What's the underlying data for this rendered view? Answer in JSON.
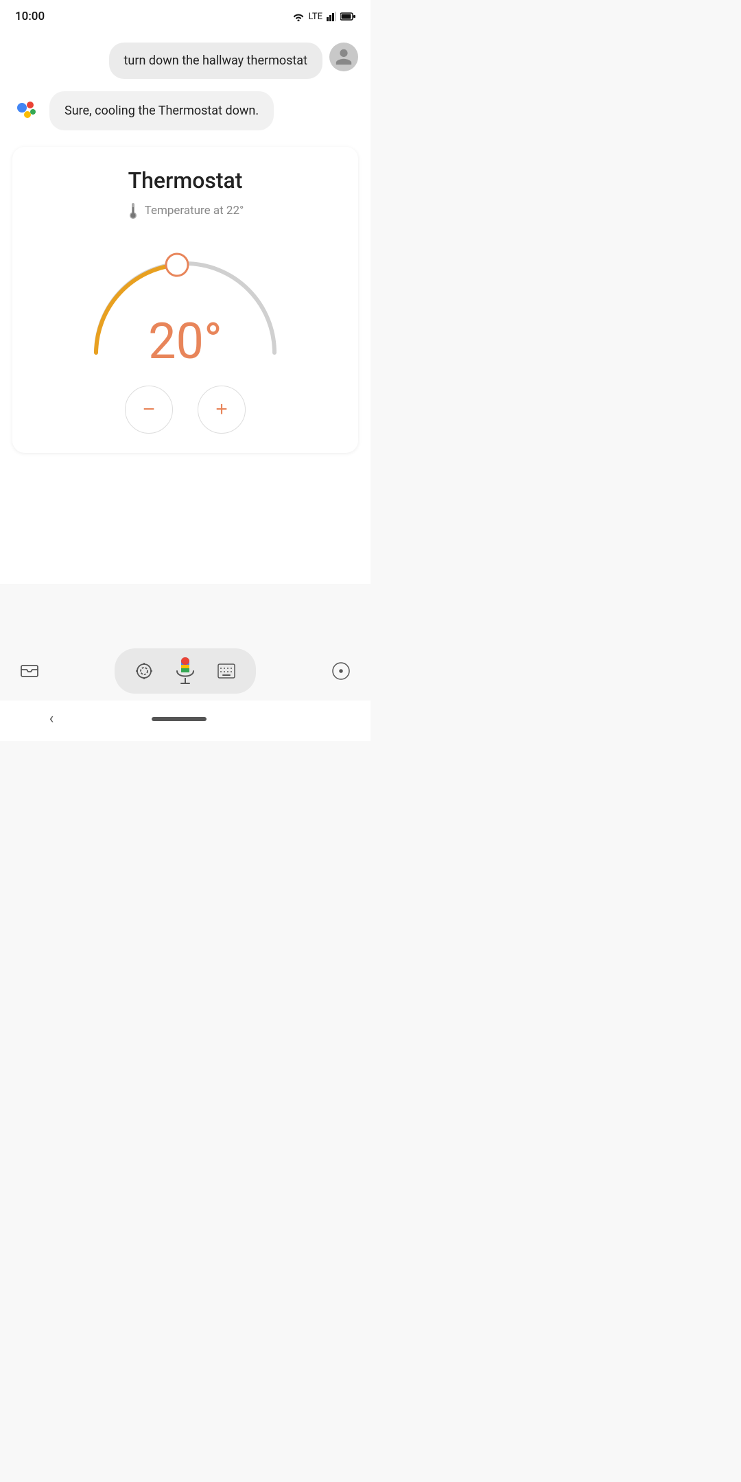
{
  "statusBar": {
    "time": "10:00",
    "lte": "LTE"
  },
  "userMessage": {
    "text": "turn down the hallway thermostat"
  },
  "assistantMessage": {
    "text": "Sure, cooling the Thermostat down."
  },
  "thermostat": {
    "title": "Thermostat",
    "tempLabel": "Temperature at 22°",
    "currentTemp": "20°",
    "minTemp": 10,
    "maxTemp": 30,
    "currentValue": 20,
    "accentColor": "#e8855a",
    "trackColor": "#ccc",
    "activeTrackColor": "#e8a020"
  },
  "controls": {
    "decreaseLabel": "−",
    "increaseLabel": "+"
  },
  "bottomBar": {
    "cameraLabel": "⊙",
    "keyboardLabel": "⌨",
    "compassLabel": "◎"
  },
  "navBar": {
    "backLabel": "‹"
  }
}
